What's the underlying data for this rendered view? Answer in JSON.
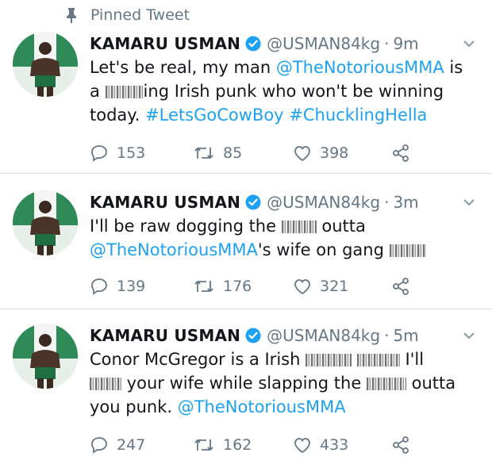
{
  "pinned": {
    "label": "Pinned Tweet",
    "icon": "pin-icon"
  },
  "colors": {
    "link": "#1da1f2",
    "muted": "#657786",
    "verified": "#1da1f2"
  },
  "tweets": [
    {
      "name": "KAMARU USMAN",
      "handle": "@USMAN84kg",
      "time": "9m",
      "line1": "Let's be real, my man ",
      "mention1": "@TheNotoriousMMA",
      "line1b": " is",
      "line2a": "a ",
      "line2b": "ing Irish punk who won't be winning",
      "line3": "today. ",
      "hashtag1": "#LetsGoCowBoy",
      "hashtag2": "#ChucklingHella",
      "replies": "153",
      "retweets": "85",
      "likes": "398"
    },
    {
      "name": "KAMARU USMAN",
      "handle": "@USMAN84kg",
      "time": "3m",
      "line1a": "I'll be raw dogging the ",
      "line1b": " outta",
      "mention": "@TheNotoriousMMA",
      "line2": "'s wife on gang ",
      "replies": "139",
      "retweets": "176",
      "likes": "321"
    },
    {
      "name": "KAMARU USMAN",
      "handle": "@USMAN84kg",
      "time": "5m",
      "line1a": "Conor McGregor is a Irish ",
      "line1b": " I'll",
      "line2a": " your wife while slapping the ",
      "line2b": " outta",
      "line3": "you punk. ",
      "mention": "@TheNotoriousMMA",
      "replies": "247",
      "retweets": "162",
      "likes": "433"
    }
  ]
}
